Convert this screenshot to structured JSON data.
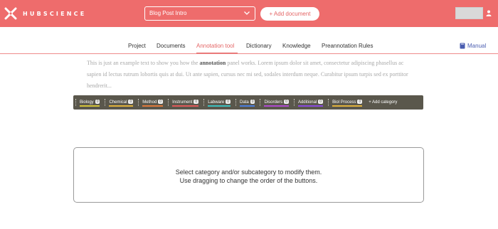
{
  "header": {
    "logo_text": "HUBSCIENCE",
    "document_select": "Blog Post Intro",
    "add_document_label": "+ Add document"
  },
  "nav": {
    "items": [
      "Project",
      "Documents",
      "Annotation tool",
      "Dictionary",
      "Knowledge",
      "Preannotation Rules"
    ],
    "active": "Annotation tool",
    "manual_label": "Manual"
  },
  "example_text": {
    "before": "This is just an example text to show you how the ",
    "highlight": "annotation",
    "after": " panel works. Lorem ipsum dolor sit amet, consectetur adipiscing phasellus ac sapien id lectus rutrum lobortis quis at dui. Ut ante sapien, cursus nec mi sed, sodales interdum neque. Curabitur ipsum turpis sed ex porttitor hendrerit..."
  },
  "panel": {
    "categories": [
      {
        "label": "Biology",
        "count": "0",
        "color": "#d4c43a"
      },
      {
        "label": "Chemical",
        "count": "0",
        "color": "#e0b23c"
      },
      {
        "label": "Method",
        "count": "0",
        "color": "#e07a3c"
      },
      {
        "label": "Instrument",
        "count": "0",
        "color": "#e05a5a"
      },
      {
        "label": "Labware",
        "count": "0",
        "color": "#3cc0c0"
      },
      {
        "label": "Data",
        "count": "0",
        "color": "#4a7ee0"
      },
      {
        "label": "Disorders",
        "count": "0",
        "color": "#b04ad0"
      },
      {
        "label": "Additional",
        "count": "0",
        "color": "#8a4ae0"
      },
      {
        "label": "Biol Process",
        "count": "0",
        "color": "#e0b23c"
      }
    ],
    "add_category_label": "+ Add category"
  },
  "info": {
    "line1": "Select category and/or subcategory to modify them.",
    "line2": "Use dragging to change the order of the buttons."
  },
  "colors": {
    "header": "#ee6c6c",
    "accent": "#e46565",
    "panel": "#5a574c",
    "link": "#4a5db0"
  }
}
